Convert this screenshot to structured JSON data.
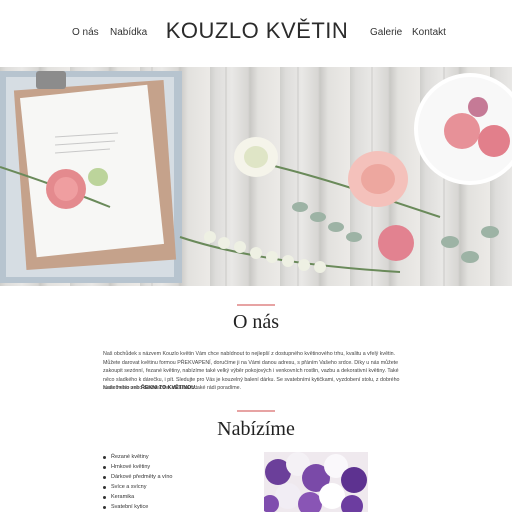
{
  "nav": {
    "left": [
      {
        "label": "O nás"
      },
      {
        "label": "Nabídka"
      }
    ],
    "right": [
      {
        "label": "Galerie"
      },
      {
        "label": "Kontakt"
      }
    ]
  },
  "logo": {
    "text": "KOUZLO KVĚTIN"
  },
  "hero": {
    "image": "flowers-on-wooden-table"
  },
  "about": {
    "title": "O nás",
    "text": "Naš obchůdek s názvem Kouzlo květin Vám chce nabídnout to nejlepší z dostupného květinového trhu, kvalitu a vřelý květin. Můžete darovat květinu formou PŘEKVAPENÍ, doručíme ji na Vámi danou adresu, s přáním Vašeho srdce. Díky u nás můžete zakoupit sezónní, řezané květiny, nabízíme také velký výběr pokojových i venkovních rostlin, vazbu a dekorativní květiny. Také něco sladkého k dárečku, i pít. Sledujte pro Vás je kouzelný balení dárku. Se svatebními kytičkami, vyzdobení stolu, z dobrého svatebního nebo darovacího auta Vám také rádi poradíme.",
    "note_prefix": "Naše heslo zní:",
    "note_bold": "ŘEKNI TO KVĚTINOU."
  },
  "offer": {
    "title": "Nabízíme",
    "items": [
      {
        "label": "Řezané květiny"
      },
      {
        "label": "Hrnkové květiny"
      },
      {
        "label": "Dárkové předměty a víno"
      },
      {
        "label": "Svíce a svícny"
      },
      {
        "label": "Keramika"
      },
      {
        "label": "Svatební kytice"
      }
    ],
    "image": "purple-white-bouquet"
  },
  "colors": {
    "accent": "#e7a3a3",
    "text": "#333333"
  }
}
